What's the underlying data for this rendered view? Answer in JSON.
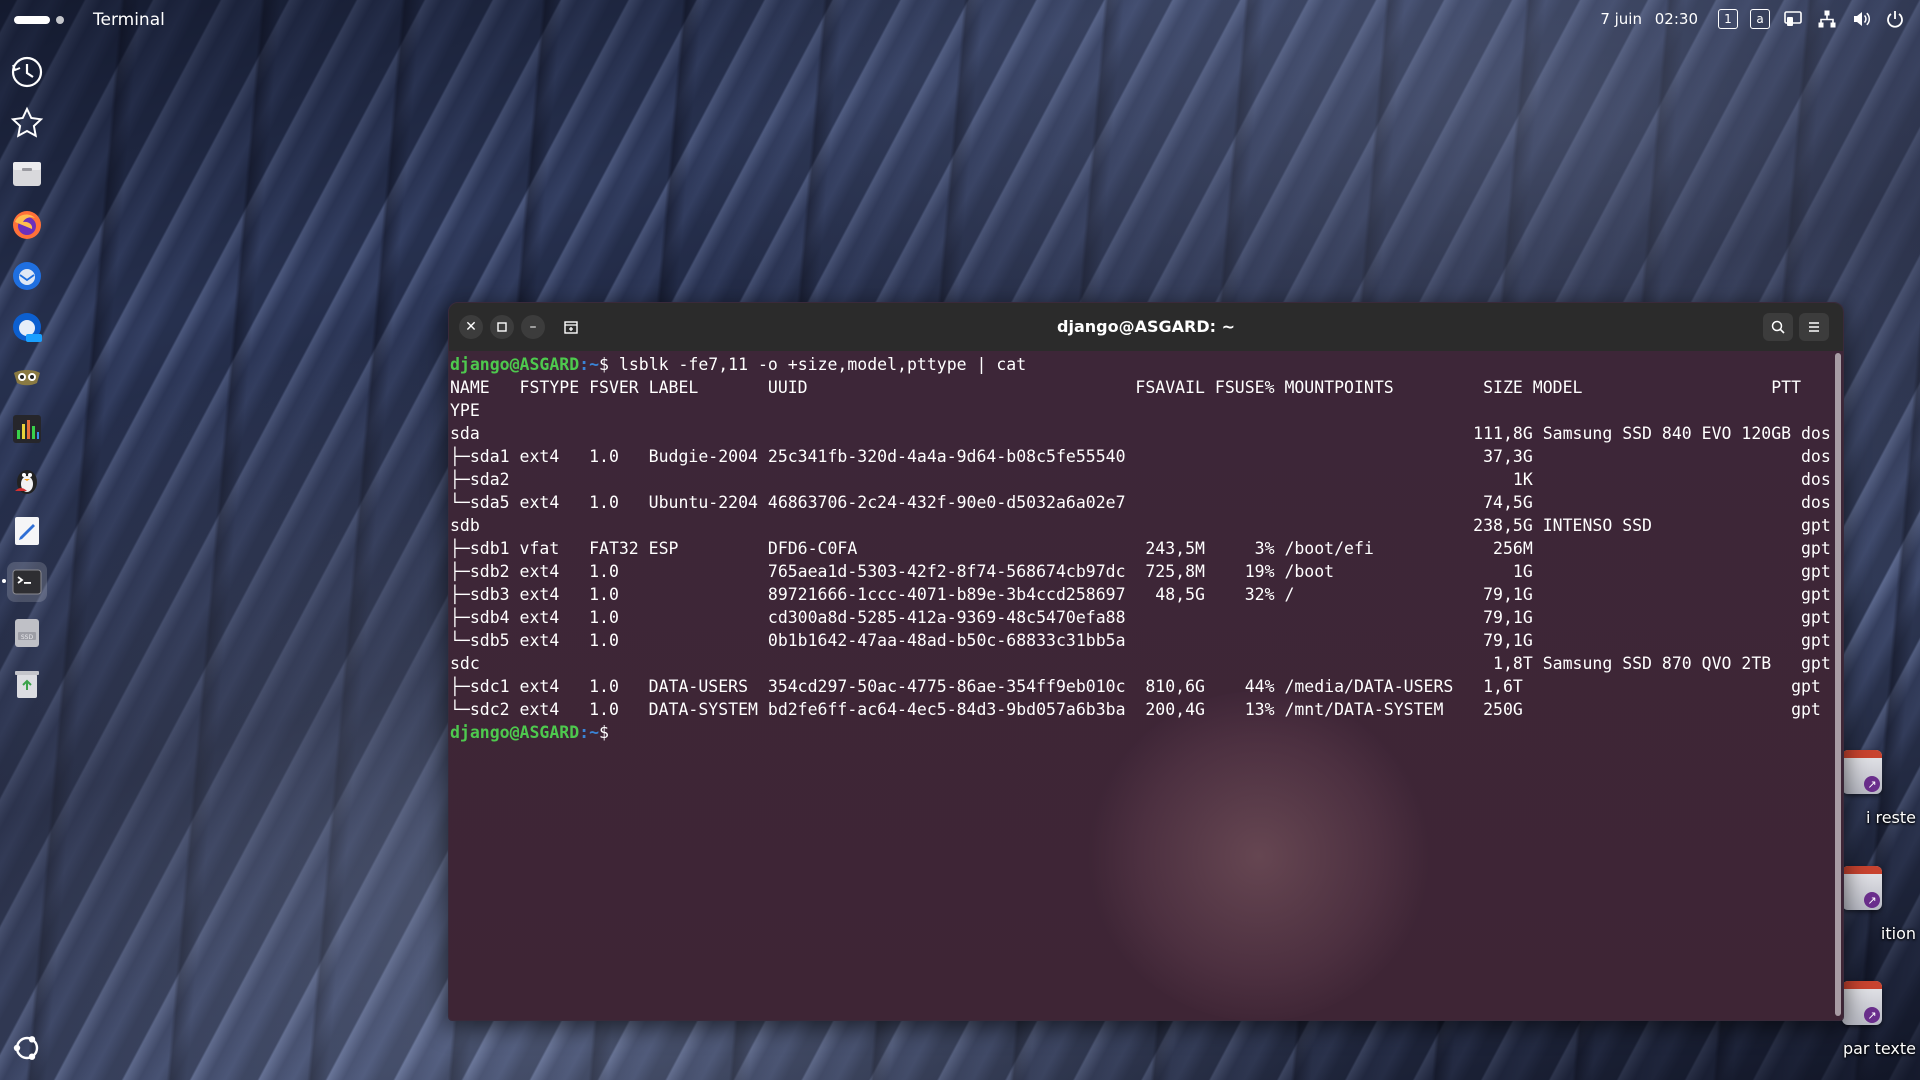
{
  "top_bar": {
    "app_name": "Terminal",
    "date": "7 juin",
    "time": "02:30",
    "tray_box_1": "1",
    "tray_box_2": "a",
    "icons": [
      "screen-share-icon",
      "network-icon",
      "volume-icon",
      "power-icon"
    ]
  },
  "dock": {
    "items": [
      {
        "name": "recent-icon"
      },
      {
        "name": "favorites-star-icon"
      },
      {
        "name": "files-icon"
      },
      {
        "name": "firefox-icon"
      },
      {
        "name": "thunderbird-icon"
      },
      {
        "name": "thunderbird-beta-icon"
      },
      {
        "name": "privacy-browser-icon"
      },
      {
        "name": "audio-equalizer-icon"
      },
      {
        "name": "penguin-app-icon"
      },
      {
        "name": "text-editor-icon"
      },
      {
        "name": "terminal-icon"
      },
      {
        "name": "ssd-drive-icon"
      },
      {
        "name": "trash-icon"
      },
      {
        "name": "ubuntu-apps-icon"
      }
    ]
  },
  "desktop_icons": [
    {
      "label": "i reste"
    },
    {
      "label": "ition"
    },
    {
      "label": "par texte"
    }
  ],
  "window": {
    "title": "django@ASGARD: ~",
    "close_glyph": "✕",
    "minimize_glyph": "–"
  },
  "terminal": {
    "prompt_user": "django@ASGARD",
    "prompt_path": ":~",
    "prompt_symbol": "$",
    "command": " lsblk -fe7,11 -o +size,model,pttype | cat",
    "output_lines": [
      "NAME   FSTYPE FSVER LABEL       UUID                                 FSAVAIL FSUSE% MOUNTPOINTS         SIZE MODEL                   PTT",
      "YPE",
      "sda                                                                                                    111,8G Samsung SSD 840 EVO 120GB dos",
      "├─sda1 ext4   1.0   Budgie-2004 25c341fb-320d-4a4a-9d64-b08c5fe55540                                    37,3G                           dos",
      "├─sda2                                                                                                     1K                           dos",
      "└─sda5 ext4   1.0   Ubuntu-2204 46863706-2c24-432f-90e0-d5032a6a02e7                                    74,5G                           dos",
      "sdb                                                                                                    238,5G INTENSO SSD               gpt",
      "├─sdb1 vfat   FAT32 ESP         DFD6-C0FA                             243,5M     3% /boot/efi            256M                           gpt",
      "├─sdb2 ext4   1.0               765aea1d-5303-42f2-8f74-568674cb97dc  725,8M    19% /boot                  1G                           gpt",
      "├─sdb3 ext4   1.0               89721666-1ccc-4071-b89e-3b4ccd258697   48,5G    32% /                   79,1G                           gpt",
      "├─sdb4 ext4   1.0               cd300a8d-5285-412a-9369-48c5470efa88                                    79,1G                           gpt",
      "└─sdb5 ext4   1.0               0b1b1642-47aa-48ad-b50c-68833c31bb5a                                    79,1G                           gpt",
      "sdc                                                                                                      1,8T Samsung SSD 870 QVO 2TB   gpt",
      "├─sdc1 ext4   1.0   DATA-USERS  354cd297-50ac-4775-86ae-354ff9eb010c  810,6G    44% /media/DATA-USERS   1,6T                           gpt",
      "└─sdc2 ext4   1.0   DATA-SYSTEM bd2fe6ff-ac64-4ec5-84d3-9bd057a6b3ba  200,4G    13% /mnt/DATA-SYSTEM    250G                           gpt"
    ]
  }
}
